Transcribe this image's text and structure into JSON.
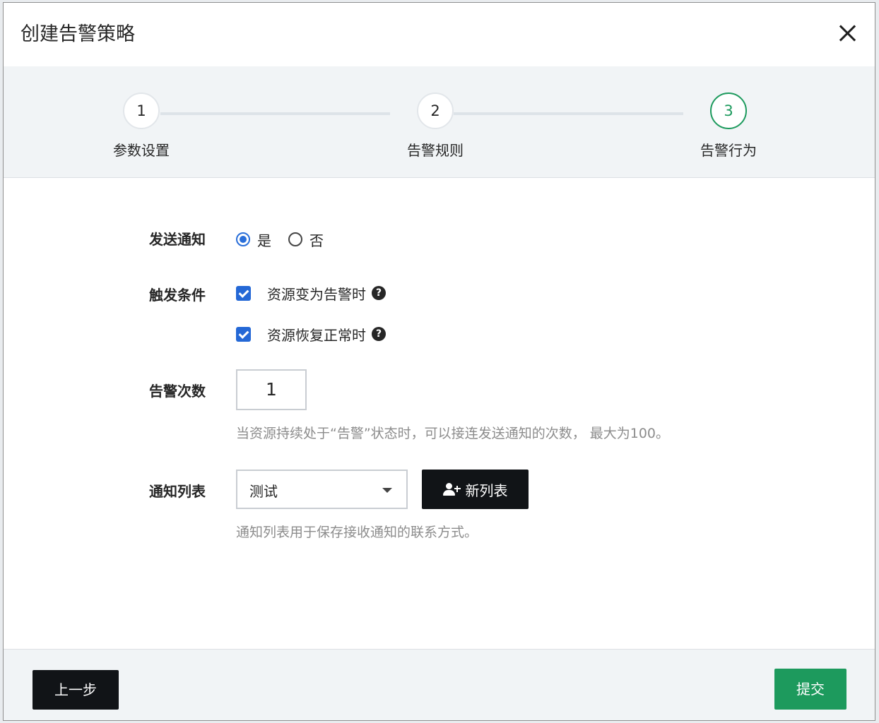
{
  "dialog": {
    "title": "创建告警策略",
    "close_icon": "close-icon"
  },
  "steps": [
    {
      "number": "1",
      "label": "参数设置"
    },
    {
      "number": "2",
      "label": "告警规则"
    },
    {
      "number": "3",
      "label": "告警行为",
      "active": true
    }
  ],
  "form": {
    "send_notification": {
      "label": "发送通知",
      "options": [
        "是",
        "否"
      ],
      "selected": "是"
    },
    "trigger": {
      "label": "触发条件",
      "options": [
        {
          "text": "资源变为告警时",
          "checked": true
        },
        {
          "text": "资源恢复正常时",
          "checked": true
        }
      ]
    },
    "alarm_count": {
      "label": "告警次数",
      "value": "1",
      "hint": "当资源持续处于“告警”状态时，可以接连发送通知的次数， 最大为100。"
    },
    "notify_list": {
      "label": "通知列表",
      "selected": "测试",
      "new_button": "新列表",
      "hint": "通知列表用于保存接收通知的联系方式。"
    }
  },
  "footer": {
    "prev_button": "上一步",
    "submit_button": "提交"
  },
  "colors": {
    "accent_green": "#1d9a5d",
    "checkbox_blue": "#2468d6",
    "dark_button": "#111417"
  }
}
